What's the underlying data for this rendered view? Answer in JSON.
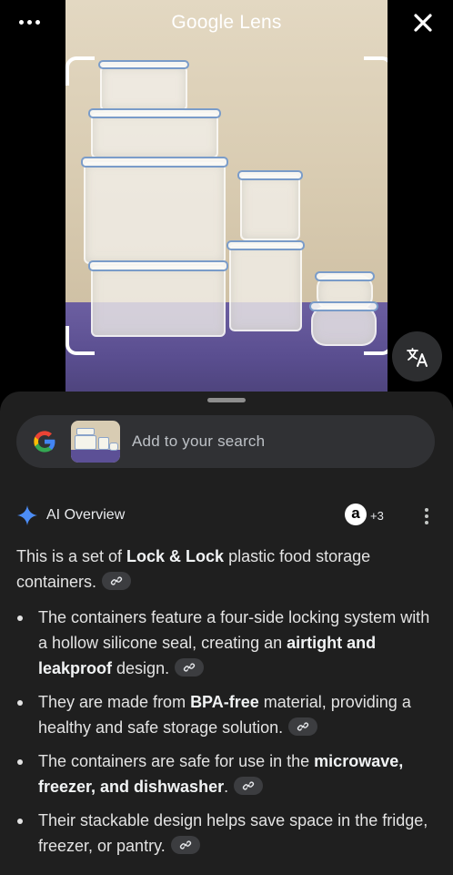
{
  "header": {
    "title": "Google Lens"
  },
  "search_bar": {
    "placeholder": "Add to your search"
  },
  "ai_overview": {
    "title": "AI Overview",
    "source_badge": "a",
    "source_count": "+3",
    "intro_pre": "This is a set of ",
    "intro_bold": "Lock & Lock",
    "intro_post": " plastic food storage containers.",
    "bullets": [
      {
        "pre": "The containers feature a four-side locking system with a hollow silicone seal, creating an ",
        "bold": "airtight and leakproof",
        "post": " design."
      },
      {
        "pre": "They are made from ",
        "bold": "BPA-free",
        "post": " material, providing a healthy and safe storage solution."
      },
      {
        "pre": "The containers are safe for use in the ",
        "bold": "microwave, freezer, and dishwasher",
        "post": "."
      },
      {
        "pre": "Their stackable design helps save space in the fridge, freezer, or pantry.",
        "bold": "",
        "post": ""
      }
    ]
  },
  "colors": {
    "sheet_bg": "#1f1f1f",
    "pill_bg": "#303134",
    "ai_spark": "#4c8df6",
    "google_blue": "#4285F4",
    "google_red": "#EA4335",
    "google_yellow": "#FBBC05",
    "google_green": "#34A853"
  },
  "icons": [
    "more-icon",
    "close-icon",
    "translate-icon",
    "google-logo-icon",
    "ai-sparkle-icon",
    "amazon-icon",
    "link-icon"
  ]
}
